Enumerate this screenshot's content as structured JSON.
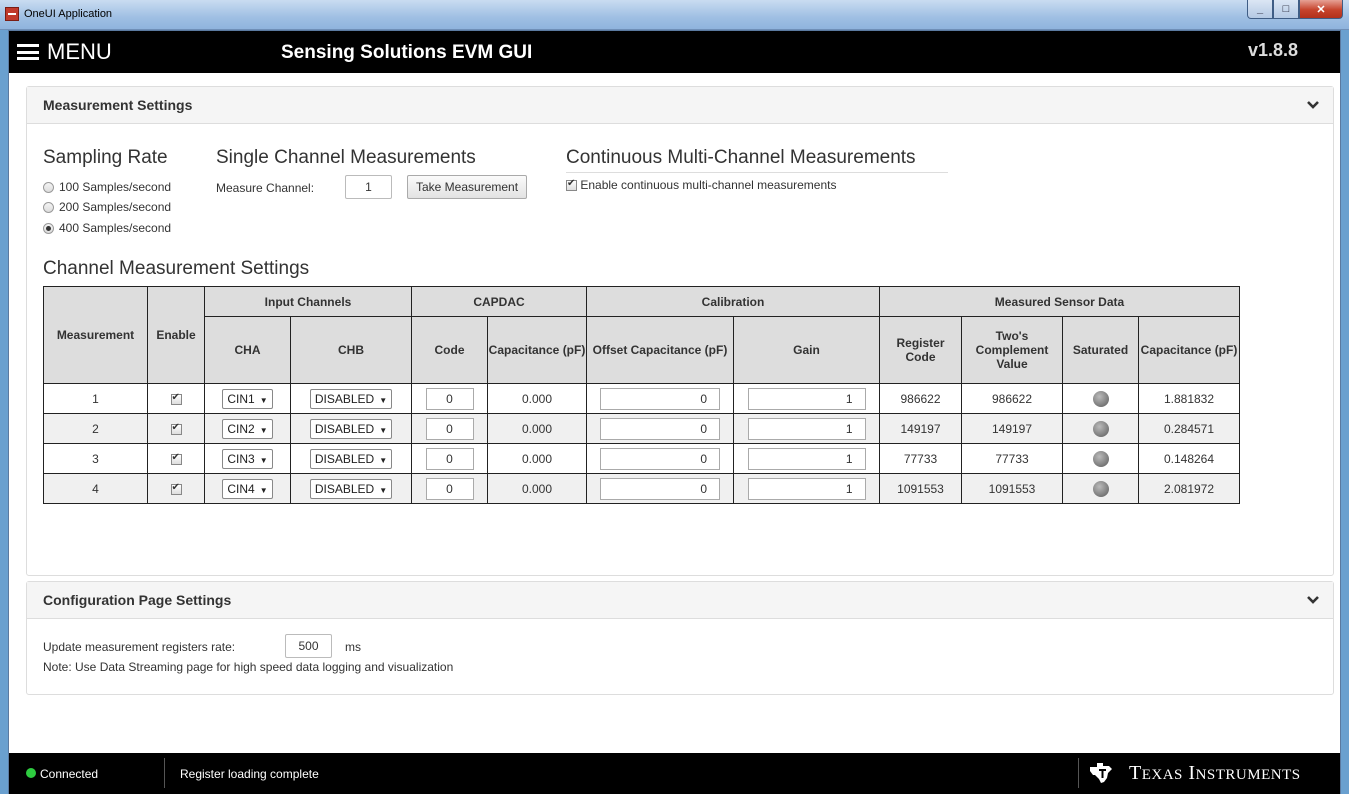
{
  "window": {
    "title": "OneUI Application",
    "min": "_",
    "max": "□",
    "close": "✕"
  },
  "appbar": {
    "menu_label": "MENU",
    "title": "Sensing Solutions EVM GUI",
    "version": "v1.8.8"
  },
  "measurement_panel": {
    "title": "Measurement Settings",
    "sampling": {
      "heading": "Sampling Rate",
      "options": [
        {
          "label": "100 Samples/second",
          "selected": false
        },
        {
          "label": "200 Samples/second",
          "selected": false
        },
        {
          "label": "400 Samples/second",
          "selected": true
        }
      ]
    },
    "single": {
      "heading": "Single Channel Measurements",
      "channel_label": "Measure Channel:",
      "channel_value": "1",
      "button": "Take Measurement"
    },
    "continuous": {
      "heading": "Continuous Multi-Channel Measurements",
      "enable_label": "Enable continuous multi-channel measurements",
      "enabled": true
    },
    "channel_heading": "Channel Measurement Settings",
    "table": {
      "group_headers": {
        "input_channels": "Input Channels",
        "capdac": "CAPDAC",
        "calibration": "Calibration",
        "measured": "Measured Sensor Data"
      },
      "headers": {
        "measurement": "Measurement",
        "enable": "Enable",
        "cha": "CHA",
        "chb": "CHB",
        "code": "Code",
        "capacitance": "Capacitance (pF)",
        "offset": "Offset Capacitance (pF)",
        "gain": "Gain",
        "register_code": "Register Code",
        "twos": "Two's Complement Value",
        "saturated": "Saturated",
        "meas_cap": "Capacitance (pF)"
      },
      "rows": [
        {
          "measurement": "1",
          "enabled": true,
          "cha": "CIN1",
          "chb": "DISABLED",
          "code": "0",
          "capacitance": "0.000",
          "offset": "0",
          "gain": "1",
          "register_code": "986622",
          "twos": "986622",
          "meas_cap": "1.881832"
        },
        {
          "measurement": "2",
          "enabled": true,
          "cha": "CIN2",
          "chb": "DISABLED",
          "code": "0",
          "capacitance": "0.000",
          "offset": "0",
          "gain": "1",
          "register_code": "149197",
          "twos": "149197",
          "meas_cap": "0.284571"
        },
        {
          "measurement": "3",
          "enabled": true,
          "cha": "CIN3",
          "chb": "DISABLED",
          "code": "0",
          "capacitance": "0.000",
          "offset": "0",
          "gain": "1",
          "register_code": "77733",
          "twos": "77733",
          "meas_cap": "0.148264"
        },
        {
          "measurement": "4",
          "enabled": true,
          "cha": "CIN4",
          "chb": "DISABLED",
          "code": "0",
          "capacitance": "0.000",
          "offset": "0",
          "gain": "1",
          "register_code": "1091553",
          "twos": "1091553",
          "meas_cap": "2.081972"
        }
      ]
    }
  },
  "config_panel": {
    "title": "Configuration Page Settings",
    "rate_label": "Update measurement registers rate:",
    "rate_value": "500",
    "rate_unit": "ms",
    "note": "Note: Use Data Streaming page for high speed data logging and visualization"
  },
  "statusbar": {
    "connection": "Connected",
    "message": "Register loading complete",
    "brand_first": "T",
    "brand_first_rest": "EXAS",
    "brand_second": "I",
    "brand_second_rest": "NSTRUMENTS"
  },
  "colors": {
    "connected": "#2ecc40",
    "header_bg": "#000000",
    "table_header_bg": "#dddddd"
  }
}
